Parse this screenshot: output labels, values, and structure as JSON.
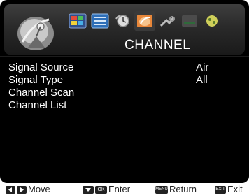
{
  "header": {
    "title": "CHANNEL",
    "tabs": [
      {
        "icon": "picture-icon"
      },
      {
        "icon": "sound-icon"
      },
      {
        "icon": "clock-icon"
      },
      {
        "icon": "channel-icon"
      },
      {
        "icon": "lock-icon"
      },
      {
        "icon": "setup-icon"
      },
      {
        "icon": "app-icon"
      }
    ],
    "active_tab_index": 3
  },
  "menu": {
    "items": [
      {
        "label": "Signal Source",
        "value": "Air"
      },
      {
        "label": "Signal Type",
        "value": "All"
      },
      {
        "label": "Channel Scan",
        "value": ""
      },
      {
        "label": "Channel List",
        "value": ""
      }
    ]
  },
  "help": {
    "move": "Move",
    "enter_key": "OK",
    "enter": "Enter",
    "return_key": "MENU",
    "return": "Return",
    "exit_key": "EXIT",
    "exit": "Exit"
  },
  "colors": {
    "background": "#000000",
    "text": "#ffffff",
    "active_tab": "#e8873a"
  }
}
